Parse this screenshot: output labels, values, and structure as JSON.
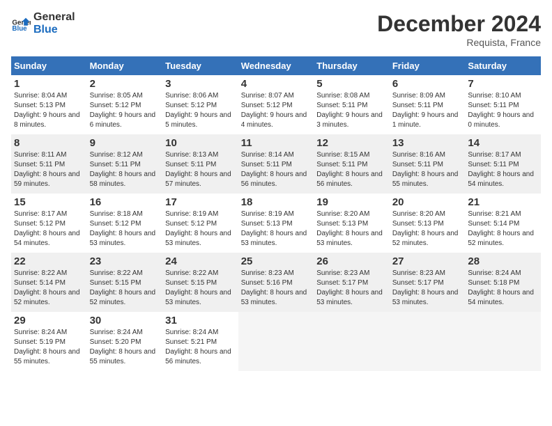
{
  "logo": {
    "line1": "General",
    "line2": "Blue"
  },
  "title": "December 2024",
  "location": "Requista, France",
  "days_of_week": [
    "Sunday",
    "Monday",
    "Tuesday",
    "Wednesday",
    "Thursday",
    "Friday",
    "Saturday"
  ],
  "weeks": [
    [
      {
        "day": "1",
        "sunrise": "8:04 AM",
        "sunset": "5:13 PM",
        "daylight": "9 hours and 8 minutes."
      },
      {
        "day": "2",
        "sunrise": "8:05 AM",
        "sunset": "5:12 PM",
        "daylight": "9 hours and 6 minutes."
      },
      {
        "day": "3",
        "sunrise": "8:06 AM",
        "sunset": "5:12 PM",
        "daylight": "9 hours and 5 minutes."
      },
      {
        "day": "4",
        "sunrise": "8:07 AM",
        "sunset": "5:12 PM",
        "daylight": "9 hours and 4 minutes."
      },
      {
        "day": "5",
        "sunrise": "8:08 AM",
        "sunset": "5:11 PM",
        "daylight": "9 hours and 3 minutes."
      },
      {
        "day": "6",
        "sunrise": "8:09 AM",
        "sunset": "5:11 PM",
        "daylight": "9 hours and 1 minute."
      },
      {
        "day": "7",
        "sunrise": "8:10 AM",
        "sunset": "5:11 PM",
        "daylight": "9 hours and 0 minutes."
      }
    ],
    [
      {
        "day": "8",
        "sunrise": "8:11 AM",
        "sunset": "5:11 PM",
        "daylight": "8 hours and 59 minutes."
      },
      {
        "day": "9",
        "sunrise": "8:12 AM",
        "sunset": "5:11 PM",
        "daylight": "8 hours and 58 minutes."
      },
      {
        "day": "10",
        "sunrise": "8:13 AM",
        "sunset": "5:11 PM",
        "daylight": "8 hours and 57 minutes."
      },
      {
        "day": "11",
        "sunrise": "8:14 AM",
        "sunset": "5:11 PM",
        "daylight": "8 hours and 56 minutes."
      },
      {
        "day": "12",
        "sunrise": "8:15 AM",
        "sunset": "5:11 PM",
        "daylight": "8 hours and 56 minutes."
      },
      {
        "day": "13",
        "sunrise": "8:16 AM",
        "sunset": "5:11 PM",
        "daylight": "8 hours and 55 minutes."
      },
      {
        "day": "14",
        "sunrise": "8:17 AM",
        "sunset": "5:11 PM",
        "daylight": "8 hours and 54 minutes."
      }
    ],
    [
      {
        "day": "15",
        "sunrise": "8:17 AM",
        "sunset": "5:12 PM",
        "daylight": "8 hours and 54 minutes."
      },
      {
        "day": "16",
        "sunrise": "8:18 AM",
        "sunset": "5:12 PM",
        "daylight": "8 hours and 53 minutes."
      },
      {
        "day": "17",
        "sunrise": "8:19 AM",
        "sunset": "5:12 PM",
        "daylight": "8 hours and 53 minutes."
      },
      {
        "day": "18",
        "sunrise": "8:19 AM",
        "sunset": "5:13 PM",
        "daylight": "8 hours and 53 minutes."
      },
      {
        "day": "19",
        "sunrise": "8:20 AM",
        "sunset": "5:13 PM",
        "daylight": "8 hours and 53 minutes."
      },
      {
        "day": "20",
        "sunrise": "8:20 AM",
        "sunset": "5:13 PM",
        "daylight": "8 hours and 52 minutes."
      },
      {
        "day": "21",
        "sunrise": "8:21 AM",
        "sunset": "5:14 PM",
        "daylight": "8 hours and 52 minutes."
      }
    ],
    [
      {
        "day": "22",
        "sunrise": "8:22 AM",
        "sunset": "5:14 PM",
        "daylight": "8 hours and 52 minutes."
      },
      {
        "day": "23",
        "sunrise": "8:22 AM",
        "sunset": "5:15 PM",
        "daylight": "8 hours and 52 minutes."
      },
      {
        "day": "24",
        "sunrise": "8:22 AM",
        "sunset": "5:15 PM",
        "daylight": "8 hours and 53 minutes."
      },
      {
        "day": "25",
        "sunrise": "8:23 AM",
        "sunset": "5:16 PM",
        "daylight": "8 hours and 53 minutes."
      },
      {
        "day": "26",
        "sunrise": "8:23 AM",
        "sunset": "5:17 PM",
        "daylight": "8 hours and 53 minutes."
      },
      {
        "day": "27",
        "sunrise": "8:23 AM",
        "sunset": "5:17 PM",
        "daylight": "8 hours and 53 minutes."
      },
      {
        "day": "28",
        "sunrise": "8:24 AM",
        "sunset": "5:18 PM",
        "daylight": "8 hours and 54 minutes."
      }
    ],
    [
      {
        "day": "29",
        "sunrise": "8:24 AM",
        "sunset": "5:19 PM",
        "daylight": "8 hours and 55 minutes."
      },
      {
        "day": "30",
        "sunrise": "8:24 AM",
        "sunset": "5:20 PM",
        "daylight": "8 hours and 55 minutes."
      },
      {
        "day": "31",
        "sunrise": "8:24 AM",
        "sunset": "5:21 PM",
        "daylight": "8 hours and 56 minutes."
      },
      null,
      null,
      null,
      null
    ]
  ]
}
